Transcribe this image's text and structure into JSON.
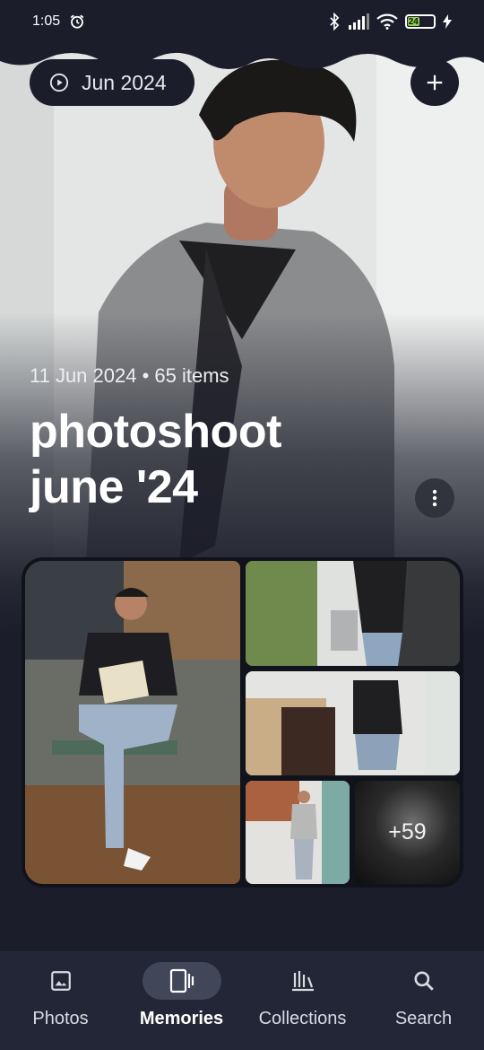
{
  "status_bar": {
    "time": "1:05",
    "battery_level": "24",
    "icons": [
      "alarm-icon",
      "bluetooth-icon",
      "signal-icon",
      "wifi-icon",
      "battery-icon",
      "charging-icon"
    ]
  },
  "memory": {
    "chip_label": "Jun 2024",
    "meta": "11 Jun 2024 • 65 items",
    "title_line1": "photoshoot",
    "title_line2": "june '24",
    "more_count": "+59"
  },
  "bottom_nav": {
    "items": [
      {
        "label": "Photos",
        "icon": "photos-icon"
      },
      {
        "label": "Memories",
        "icon": "memories-icon",
        "active": true
      },
      {
        "label": "Collections",
        "icon": "collections-icon"
      },
      {
        "label": "Search",
        "icon": "search-icon"
      }
    ]
  },
  "colors": {
    "background": "#1b1d2a",
    "nav_background": "#232636",
    "active_pill": "#414659",
    "battery_fill": "#8fd14f"
  }
}
